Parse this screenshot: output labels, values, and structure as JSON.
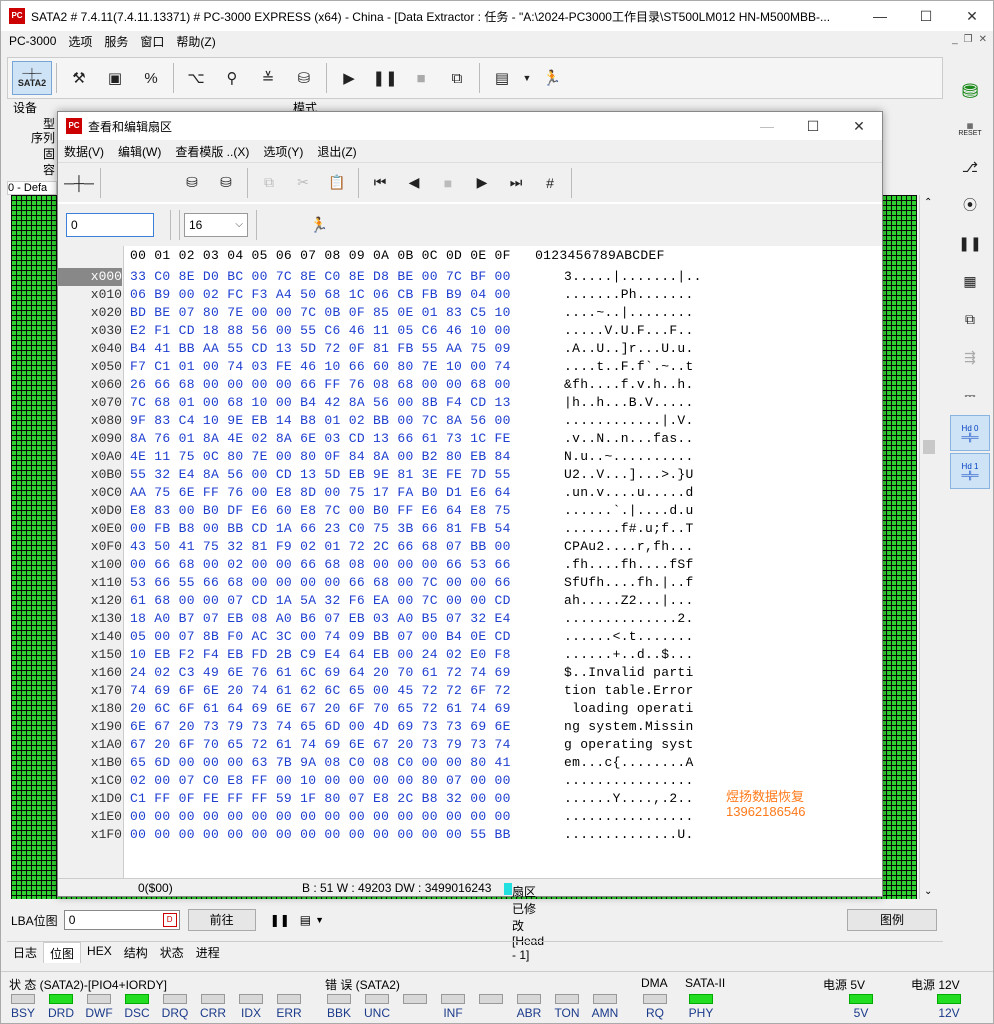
{
  "window": {
    "title": "SATA2 # 7.4.11(7.4.11.13371) # PC-3000 EXPRESS (x64) - China - [Data Extractor : 任务 - \"A:\\2024-PC3000工作目录\\ST500LM012 HN-M500MBB-...",
    "icon_text": "PC",
    "minimize": "—",
    "maximize": "☐",
    "close": "✕"
  },
  "menubar": {
    "items": [
      "PC-3000",
      "选项",
      "服务",
      "窗口",
      "帮助(Z)"
    ],
    "mdi_buttons": [
      "_",
      "❐",
      "✕"
    ]
  },
  "toolbar": {
    "sata_label": "SATA2",
    "icons": [
      "tools-icon",
      "chip-icon",
      "percent-chip-icon",
      "probe-icon",
      "binoculars-icon",
      "stack-icon",
      "disk-icon",
      "play-icon",
      "pause-icon",
      "stop-icon",
      "copy-icon",
      "monitor-icon",
      "dropdown-icon",
      "run-icon"
    ]
  },
  "device_panel": {
    "left_label": "设备",
    "mode_label": "模式",
    "rows": [
      "型",
      "序列",
      "固",
      "容"
    ]
  },
  "tab_label": "0 - Defa",
  "right_sidebar": {
    "icons": [
      "db-green-icon",
      "reset-icon",
      "branch-icon",
      "scan-icon",
      "pause-icon",
      "grid-icon",
      "layers-icon",
      "nav-icon",
      "connector-icon",
      "hd0-icon",
      "hd1-icon"
    ],
    "reset_label": "RESET",
    "hd0_label": "Hd 0",
    "hd1_label": "Hd 1"
  },
  "dialog": {
    "title": "查看和编辑扇区",
    "menu": [
      "数据(V)",
      "编辑(W)",
      "查看模版 ..(X)",
      "选项(Y)",
      "退出(Z)"
    ],
    "address_value": "0",
    "bytes_per_row": "16",
    "hex_header": "00 01 02 03 04 05 06 07 08 09 0A 0B 0C 0D 0E 0F",
    "ascii_header": "0123456789ABCDEF",
    "rows": [
      {
        "off": "x000",
        "hex": "33 C0 8E D0 BC 00 7C 8E C0 8E D8 BE 00 7C BF 00",
        "asc": "3.....|.......|.."
      },
      {
        "off": "x010",
        "hex": "06 B9 00 02 FC F3 A4 50 68 1C 06 CB FB B9 04 00",
        "asc": ".......Ph......."
      },
      {
        "off": "x020",
        "hex": "BD BE 07 80 7E 00 00 7C 0B 0F 85 0E 01 83 C5 10",
        "asc": "....~..|........"
      },
      {
        "off": "x030",
        "hex": "E2 F1 CD 18 88 56 00 55 C6 46 11 05 C6 46 10 00",
        "asc": ".....V.U.F...F.."
      },
      {
        "off": "x040",
        "hex": "B4 41 BB AA 55 CD 13 5D 72 0F 81 FB 55 AA 75 09",
        "asc": ".A..U..]r...U.u."
      },
      {
        "off": "x050",
        "hex": "F7 C1 01 00 74 03 FE 46 10 66 60 80 7E 10 00 74",
        "asc": "....t..F.f`.~..t"
      },
      {
        "off": "x060",
        "hex": "26 66 68 00 00 00 00 66 FF 76 08 68 00 00 68 00",
        "asc": "&fh....f.v.h..h."
      },
      {
        "off": "x070",
        "hex": "7C 68 01 00 68 10 00 B4 42 8A 56 00 8B F4 CD 13",
        "asc": "|h..h...B.V....."
      },
      {
        "off": "x080",
        "hex": "9F 83 C4 10 9E EB 14 B8 01 02 BB 00 7C 8A 56 00",
        "asc": "............|.V."
      },
      {
        "off": "x090",
        "hex": "8A 76 01 8A 4E 02 8A 6E 03 CD 13 66 61 73 1C FE",
        "asc": ".v..N..n...fas.."
      },
      {
        "off": "x0A0",
        "hex": "4E 11 75 0C 80 7E 00 80 0F 84 8A 00 B2 80 EB 84",
        "asc": "N.u..~.........."
      },
      {
        "off": "x0B0",
        "hex": "55 32 E4 8A 56 00 CD 13 5D EB 9E 81 3E FE 7D 55",
        "asc": "U2..V...]...>.}U"
      },
      {
        "off": "x0C0",
        "hex": "AA 75 6E FF 76 00 E8 8D 00 75 17 FA B0 D1 E6 64",
        "asc": ".un.v....u.....d"
      },
      {
        "off": "x0D0",
        "hex": "E8 83 00 B0 DF E6 60 E8 7C 00 B0 FF E6 64 E8 75",
        "asc": "......`.|....d.u"
      },
      {
        "off": "x0E0",
        "hex": "00 FB B8 00 BB CD 1A 66 23 C0 75 3B 66 81 FB 54",
        "asc": ".......f#.u;f..T"
      },
      {
        "off": "x0F0",
        "hex": "43 50 41 75 32 81 F9 02 01 72 2C 66 68 07 BB 00",
        "asc": "CPAu2....r,fh..."
      },
      {
        "off": "x100",
        "hex": "00 66 68 00 02 00 00 66 68 08 00 00 00 66 53 66",
        "asc": ".fh....fh....fSf"
      },
      {
        "off": "x110",
        "hex": "53 66 55 66 68 00 00 00 00 66 68 00 7C 00 00 66",
        "asc": "SfUfh....fh.|..f"
      },
      {
        "off": "x120",
        "hex": "61 68 00 00 07 CD 1A 5A 32 F6 EA 00 7C 00 00 CD",
        "asc": "ah.....Z2...|..."
      },
      {
        "off": "x130",
        "hex": "18 A0 B7 07 EB 08 A0 B6 07 EB 03 A0 B5 07 32 E4",
        "asc": "..............2."
      },
      {
        "off": "x140",
        "hex": "05 00 07 8B F0 AC 3C 00 74 09 BB 07 00 B4 0E CD",
        "asc": "......<.t......."
      },
      {
        "off": "x150",
        "hex": "10 EB F2 F4 EB FD 2B C9 E4 64 EB 00 24 02 E0 F8",
        "asc": "......+..d..$..."
      },
      {
        "off": "x160",
        "hex": "24 02 C3 49 6E 76 61 6C 69 64 20 70 61 72 74 69",
        "asc": "$..Invalid parti"
      },
      {
        "off": "x170",
        "hex": "74 69 6F 6E 20 74 61 62 6C 65 00 45 72 72 6F 72",
        "asc": "tion table.Error"
      },
      {
        "off": "x180",
        "hex": "20 6C 6F 61 64 69 6E 67 20 6F 70 65 72 61 74 69",
        "asc": " loading operati"
      },
      {
        "off": "x190",
        "hex": "6E 67 20 73 79 73 74 65 6D 00 4D 69 73 73 69 6E",
        "asc": "ng system.Missin"
      },
      {
        "off": "x1A0",
        "hex": "67 20 6F 70 65 72 61 74 69 6E 67 20 73 79 73 74",
        "asc": "g operating syst"
      },
      {
        "off": "x1B0",
        "hex": "65 6D 00 00 00 63 7B 9A 08 C0 08 C0 00 00 80 41",
        "asc": "em...c{........A"
      },
      {
        "off": "x1C0",
        "hex": "02 00 07 C0 E8 FF 00 10 00 00 00 00 80 07 00 00",
        "asc": "................"
      },
      {
        "off": "x1D0",
        "hex": "C1 FF 0F FE FF FF 59 1F 80 07 E8 2C B8 32 00 00",
        "asc": "......Y....,.2.."
      },
      {
        "off": "x1E0",
        "hex": "00 00 00 00 00 00 00 00 00 00 00 00 00 00 00 00",
        "asc": "................"
      },
      {
        "off": "x1F0",
        "hex": "00 00 00 00 00 00 00 00 00 00 00 00 00 00 55 BB",
        "asc": "..............U."
      }
    ],
    "watermark_line1": "煜扬数据恢复",
    "watermark_line2": "13962186546",
    "status_offset": "0($00)",
    "status_values": "B : 51 W : 49203 DW : 3499016243",
    "status_modified": "扇区已修改[Head - 1]"
  },
  "lba_row": {
    "label": "LBA位图",
    "value": "0",
    "goto_button": "前往",
    "legend_button": "图例"
  },
  "bottom_tabs": [
    "日志",
    "位图",
    "HEX",
    "结构",
    "状态",
    "进程"
  ],
  "selected_tab": "位图",
  "status": {
    "group1_title": "状 态 (SATA2)-[PIO4+IORDY]",
    "group2_title": "错 误 (SATA2)",
    "dma_title": "DMA",
    "sata_title": "SATA-II",
    "power5_title": "电源 5V",
    "power12_title": "电源 12V",
    "leds": [
      {
        "label": "BSY",
        "on": false
      },
      {
        "label": "DRD",
        "on": true
      },
      {
        "label": "DWF",
        "on": false
      },
      {
        "label": "DSC",
        "on": true
      },
      {
        "label": "DRQ",
        "on": false
      },
      {
        "label": "CRR",
        "on": false
      },
      {
        "label": "IDX",
        "on": false
      },
      {
        "label": "ERR",
        "on": false
      },
      {
        "label": "BBK",
        "on": false
      },
      {
        "label": "UNC",
        "on": false
      },
      {
        "label": "",
        "on": false
      },
      {
        "label": "INF",
        "on": false
      },
      {
        "label": "",
        "on": false
      },
      {
        "label": "ABR",
        "on": false
      },
      {
        "label": "TON",
        "on": false
      },
      {
        "label": "AMN",
        "on": false
      },
      {
        "label": "RQ",
        "on": false
      },
      {
        "label": "PHY",
        "on": true
      },
      {
        "label": "5V",
        "on": true
      },
      {
        "label": "12V",
        "on": true
      }
    ],
    "accent_on": "#22dd22"
  }
}
